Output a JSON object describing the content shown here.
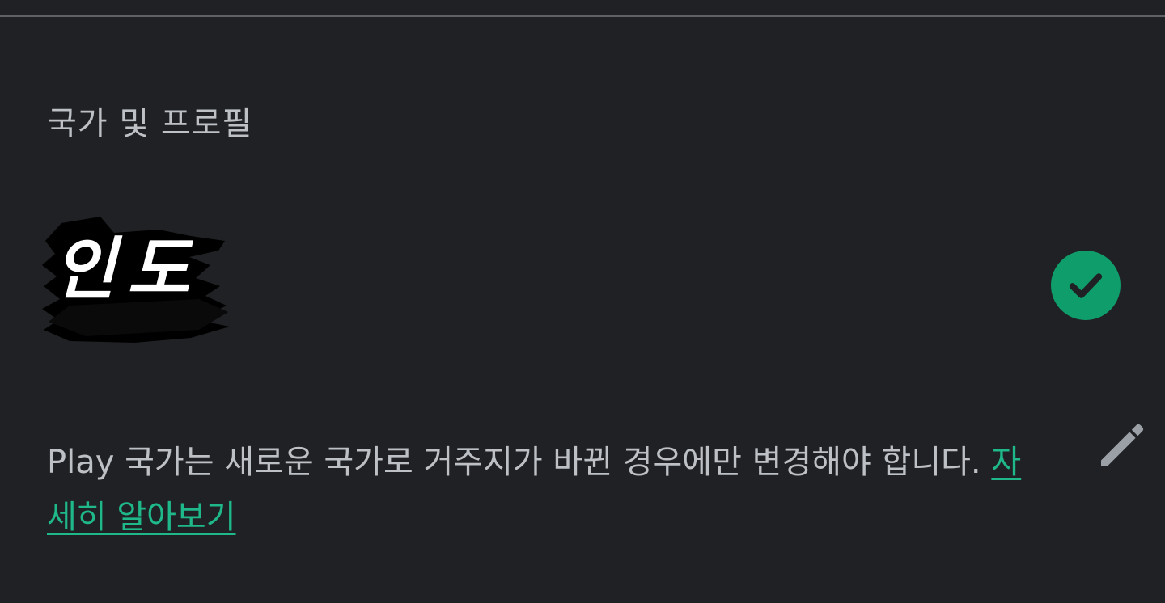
{
  "section": {
    "title": "국가 및 프로필"
  },
  "country": {
    "name": "인도",
    "selected_icon": "check-circle-icon",
    "accent_color": "#0f9d6b"
  },
  "info": {
    "text": "Play 국가는 새로운 국가로 거주지가 바뀐 경우에만 변경해야 합니다. ",
    "link_label": "자세히 알아보기",
    "link_color": "#1fb88a"
  },
  "edit": {
    "icon": "pencil-icon"
  }
}
